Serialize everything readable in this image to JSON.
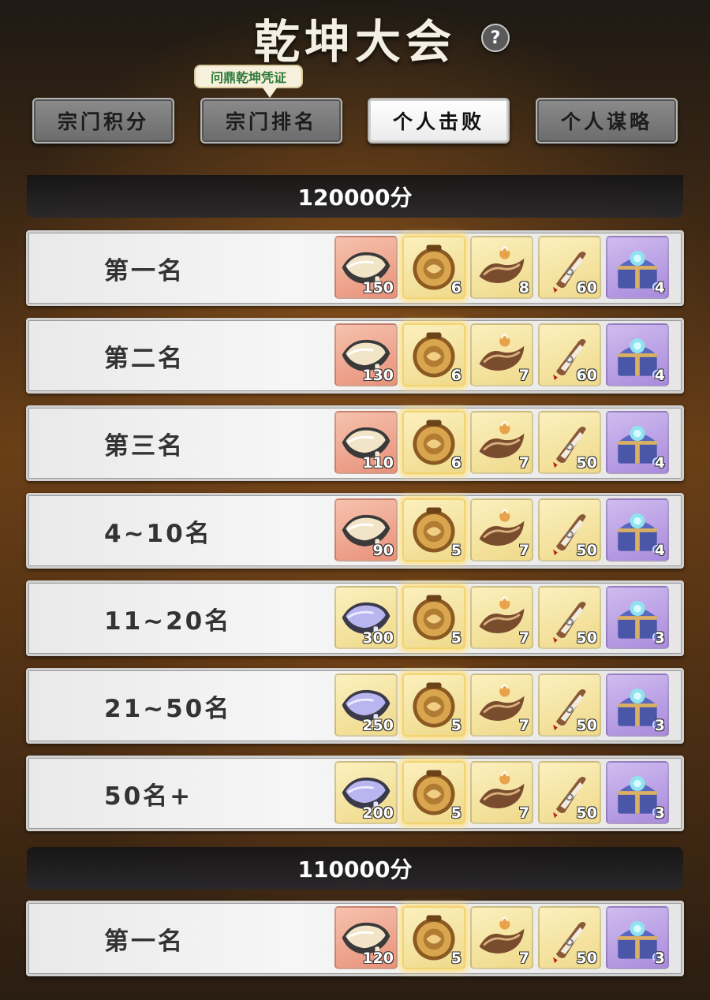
{
  "page": {
    "title": "乾坤大会",
    "help_label": "?",
    "tooltip": "问鼎乾坤凭证"
  },
  "tabs": [
    {
      "label": "宗门积分"
    },
    {
      "label": "宗门排名"
    },
    {
      "label": "个人击败",
      "active": true
    },
    {
      "label": "个人谋略"
    }
  ],
  "sections": [
    {
      "score_label": "120000分",
      "rows": [
        {
          "rank": "第一名",
          "items": [
            {
              "icon": "silver-ingot-icon",
              "bg": "red",
              "count": "150"
            },
            {
              "icon": "gold-medallion-icon",
              "bg": "gold",
              "count": "6"
            },
            {
              "icon": "scroll-cloak-icon",
              "bg": "gold",
              "count": "8"
            },
            {
              "icon": "paper-scroll-icon",
              "bg": "gold",
              "count": "60"
            },
            {
              "icon": "treasure-chest-icon",
              "bg": "purple",
              "count": "4"
            }
          ]
        },
        {
          "rank": "第二名",
          "items": [
            {
              "icon": "silver-ingot-icon",
              "bg": "red",
              "count": "130"
            },
            {
              "icon": "gold-medallion-icon",
              "bg": "gold",
              "count": "6"
            },
            {
              "icon": "scroll-cloak-icon",
              "bg": "gold",
              "count": "7"
            },
            {
              "icon": "paper-scroll-icon",
              "bg": "gold",
              "count": "60"
            },
            {
              "icon": "treasure-chest-icon",
              "bg": "purple",
              "count": "4"
            }
          ]
        },
        {
          "rank": "第三名",
          "items": [
            {
              "icon": "silver-ingot-icon",
              "bg": "red",
              "count": "110"
            },
            {
              "icon": "gold-medallion-icon",
              "bg": "gold",
              "count": "6"
            },
            {
              "icon": "scroll-cloak-icon",
              "bg": "gold",
              "count": "7"
            },
            {
              "icon": "paper-scroll-icon",
              "bg": "gold",
              "count": "50"
            },
            {
              "icon": "treasure-chest-icon",
              "bg": "purple",
              "count": "4"
            }
          ]
        },
        {
          "rank": "4~10名",
          "items": [
            {
              "icon": "silver-ingot-icon",
              "bg": "red",
              "count": "90"
            },
            {
              "icon": "gold-medallion-icon",
              "bg": "gold",
              "count": "5"
            },
            {
              "icon": "scroll-cloak-icon",
              "bg": "gold",
              "count": "7"
            },
            {
              "icon": "paper-scroll-icon",
              "bg": "gold",
              "count": "50"
            },
            {
              "icon": "treasure-chest-icon",
              "bg": "purple",
              "count": "4"
            }
          ]
        },
        {
          "rank": "11~20名",
          "items": [
            {
              "icon": "blue-ingot-icon",
              "bg": "gold",
              "count": "300"
            },
            {
              "icon": "gold-medallion-icon",
              "bg": "gold",
              "count": "5"
            },
            {
              "icon": "scroll-cloak-icon",
              "bg": "gold",
              "count": "7"
            },
            {
              "icon": "paper-scroll-icon",
              "bg": "gold",
              "count": "50"
            },
            {
              "icon": "treasure-chest-icon",
              "bg": "purple",
              "count": "3"
            }
          ]
        },
        {
          "rank": "21~50名",
          "items": [
            {
              "icon": "blue-ingot-icon",
              "bg": "gold",
              "count": "250"
            },
            {
              "icon": "gold-medallion-icon",
              "bg": "gold",
              "count": "5"
            },
            {
              "icon": "scroll-cloak-icon",
              "bg": "gold",
              "count": "7"
            },
            {
              "icon": "paper-scroll-icon",
              "bg": "gold",
              "count": "50"
            },
            {
              "icon": "treasure-chest-icon",
              "bg": "purple",
              "count": "3"
            }
          ]
        },
        {
          "rank": "50名+",
          "items": [
            {
              "icon": "blue-ingot-icon",
              "bg": "gold",
              "count": "200"
            },
            {
              "icon": "gold-medallion-icon",
              "bg": "gold",
              "count": "5"
            },
            {
              "icon": "scroll-cloak-icon",
              "bg": "gold",
              "count": "7"
            },
            {
              "icon": "paper-scroll-icon",
              "bg": "gold",
              "count": "50"
            },
            {
              "icon": "treasure-chest-icon",
              "bg": "purple",
              "count": "3"
            }
          ]
        }
      ]
    },
    {
      "score_label": "110000分",
      "rows": [
        {
          "rank": "第一名",
          "items": [
            {
              "icon": "silver-ingot-icon",
              "bg": "red",
              "count": "120"
            },
            {
              "icon": "gold-medallion-icon",
              "bg": "gold",
              "count": "5"
            },
            {
              "icon": "scroll-cloak-icon",
              "bg": "gold",
              "count": "7"
            },
            {
              "icon": "paper-scroll-icon",
              "bg": "gold",
              "count": "50"
            },
            {
              "icon": "treasure-chest-icon",
              "bg": "purple",
              "count": "3"
            }
          ]
        }
      ]
    }
  ]
}
